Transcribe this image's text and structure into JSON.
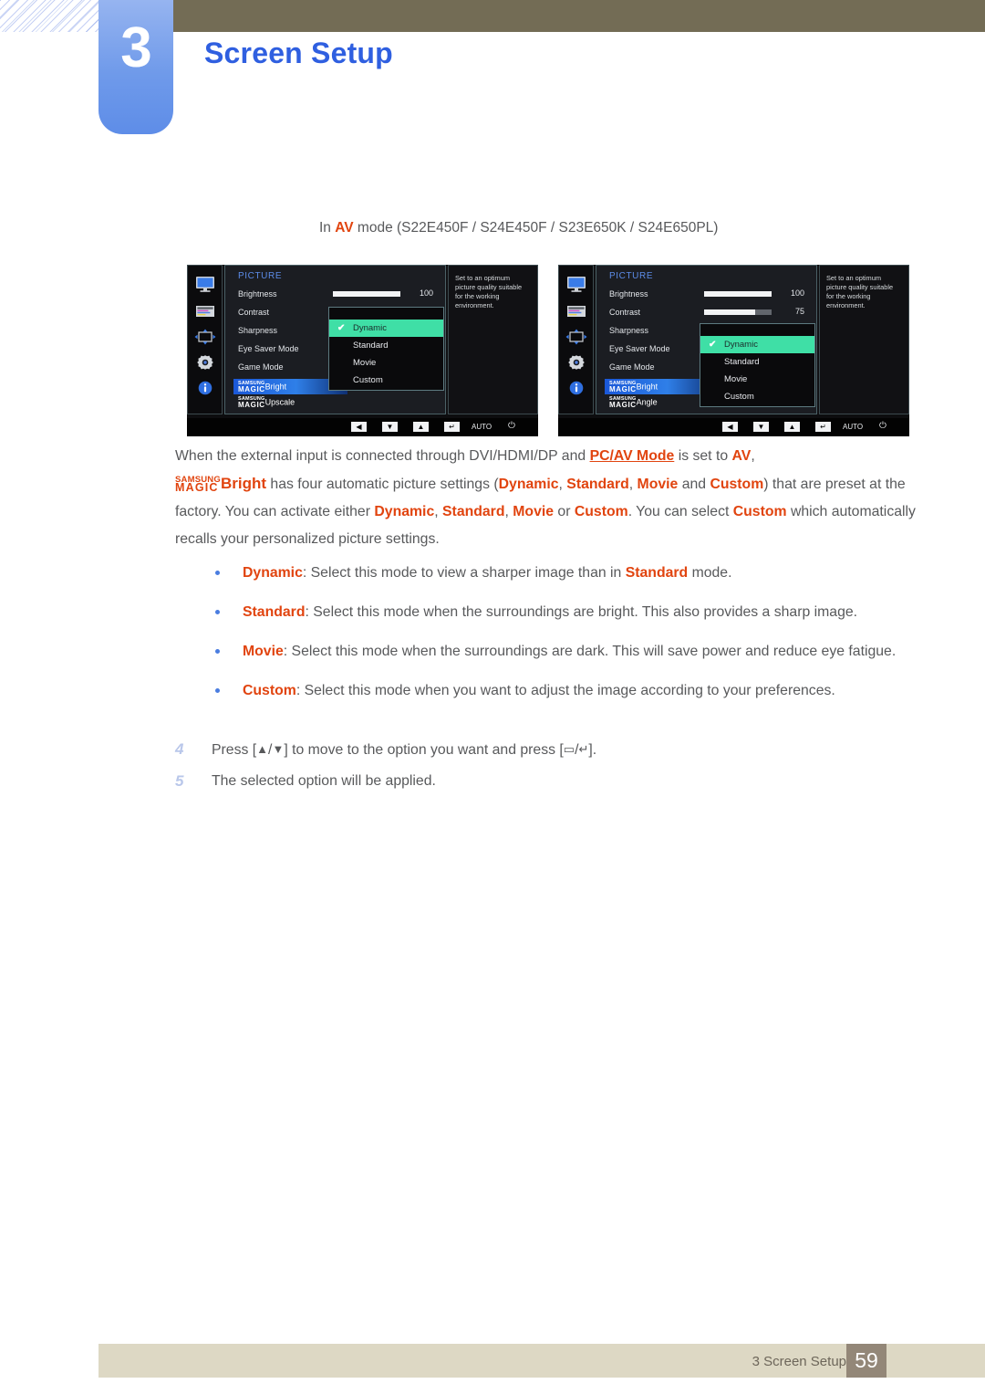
{
  "header": {
    "chapter_number": "3",
    "chapter_title": "Screen Setup"
  },
  "caption": {
    "prefix": "In ",
    "mode": "AV",
    "suffix": " mode (S22E450F / S24E450F / S23E650K / S24E650PL)"
  },
  "osd_left": {
    "heading": "PICTURE",
    "menu_items": [
      "Brightness",
      "Contrast",
      "Sharpness",
      "Eye Saver Mode",
      "Game Mode"
    ],
    "magic_items": [
      {
        "top": "SAMSUNG",
        "bottom": "MAGIC",
        "suffix": "Bright",
        "highlighted": true
      },
      {
        "top": "SAMSUNG",
        "bottom": "MAGIC",
        "suffix": "Upscale",
        "highlighted": false
      }
    ],
    "sliders": [
      {
        "label": "Brightness",
        "value": "100",
        "fill_percent": 100
      }
    ],
    "popup_options": [
      "Dynamic",
      "Standard",
      "Movie",
      "Custom"
    ],
    "popup_selected": "Dynamic",
    "check_glyph": "✔",
    "tooltip": "Set to an optimum picture quality suitable for the working environment.",
    "footbar": {
      "buttons": [
        "◀",
        "▼",
        "▲",
        "↵"
      ],
      "auto_label": "AUTO",
      "power_glyph": "⏻"
    },
    "icons": [
      "monitor-icon",
      "onscreen-display-icon",
      "position-arrows-icon",
      "gear-icon",
      "information-icon"
    ]
  },
  "osd_right": {
    "heading": "PICTURE",
    "menu_items": [
      "Brightness",
      "Contrast",
      "Sharpness",
      "Eye Saver Mode",
      "Game Mode"
    ],
    "magic_items": [
      {
        "top": "SAMSUNG",
        "bottom": "MAGIC",
        "suffix": "Bright",
        "highlighted": true
      },
      {
        "top": "SAMSUNG",
        "bottom": "MAGIC",
        "suffix": "Angle",
        "highlighted": false
      }
    ],
    "sliders": [
      {
        "label": "Brightness",
        "value": "100",
        "fill_percent": 100
      },
      {
        "label": "Contrast",
        "value": "75",
        "fill_percent": 75
      }
    ],
    "popup_options": [
      "Dynamic",
      "Standard",
      "Movie",
      "Custom"
    ],
    "popup_selected": "Dynamic",
    "check_glyph": "✔",
    "tooltip": "Set to an optimum picture quality suitable for the working environment.",
    "footbar": {
      "buttons": [
        "◀",
        "▼",
        "▲",
        "↵"
      ],
      "auto_label": "AUTO",
      "power_glyph": "⏻"
    },
    "icons": [
      "monitor-icon",
      "onscreen-display-icon",
      "position-arrows-icon",
      "gear-icon",
      "information-icon"
    ]
  },
  "body": {
    "para_p1": "When the external input is connected through DVI/HDMI/DP and ",
    "pc_av_mode": "PC/AV Mode",
    "para_p2": " is set to ",
    "av": "AV",
    "para_p3": ",",
    "magic_top": "SAMSUNG",
    "magic_bottom": "MAGIC",
    "magic_suffix": "Bright",
    "para_p4": " has four automatic picture settings (",
    "w_dynamic": "Dynamic",
    "para_p5": ", ",
    "w_standard": "Standard",
    "para_p6": ", ",
    "w_movie": "Movie",
    "para_p7": " and ",
    "w_custom": "Custom",
    "para_p8": ") that are preset at the factory. You can activate either ",
    "para_p9": ", ",
    "para_p10": ", ",
    "para_p11": " or ",
    "para_p12": ". You can select ",
    "para_p13": " which automatically recalls your personalized picture settings."
  },
  "bullets": [
    {
      "term": "Dynamic",
      "text_a": ": Select this mode to view a sharper image than in ",
      "term_b": "Standard",
      "text_b": " mode."
    },
    {
      "term": "Standard",
      "text_a": ": Select this mode when the surroundings are bright. This also provides a sharp image.",
      "term_b": "",
      "text_b": ""
    },
    {
      "term": "Movie",
      "text_a": ": Select this mode when the surroundings are dark. This will save power and reduce eye fatigue.",
      "term_b": "",
      "text_b": ""
    },
    {
      "term": "Custom",
      "text_a": ": Select this mode when you want to adjust the image according to your preferences.",
      "term_b": "",
      "text_b": ""
    }
  ],
  "steps": [
    {
      "num": "4",
      "pre": "Press [",
      "keys_up": "▲",
      "keys_sep": "/",
      "keys_down": "▼",
      "mid": "] to move to the option you want and press [",
      "key_a": "▭",
      "key_sep": "/",
      "key_b": "↵",
      "post": "]."
    },
    {
      "num": "5",
      "pre": "The selected option will be applied.",
      "keys_up": "",
      "keys_sep": "",
      "keys_down": "",
      "mid": "",
      "key_a": "",
      "key_sep": "",
      "key_b": "",
      "post": ""
    }
  ],
  "footer": {
    "text": "3 Screen Setup",
    "page": "59"
  },
  "colors": {
    "accent_orange": "#e1440f",
    "title_blue": "#2f5fe0",
    "olive_band": "#736c55",
    "footer_bg": "#ddd8c4",
    "page_badge": "#938778",
    "osd_select_green": "#3fdfa6",
    "osd_highlight_blue": "#2f7fe8"
  }
}
